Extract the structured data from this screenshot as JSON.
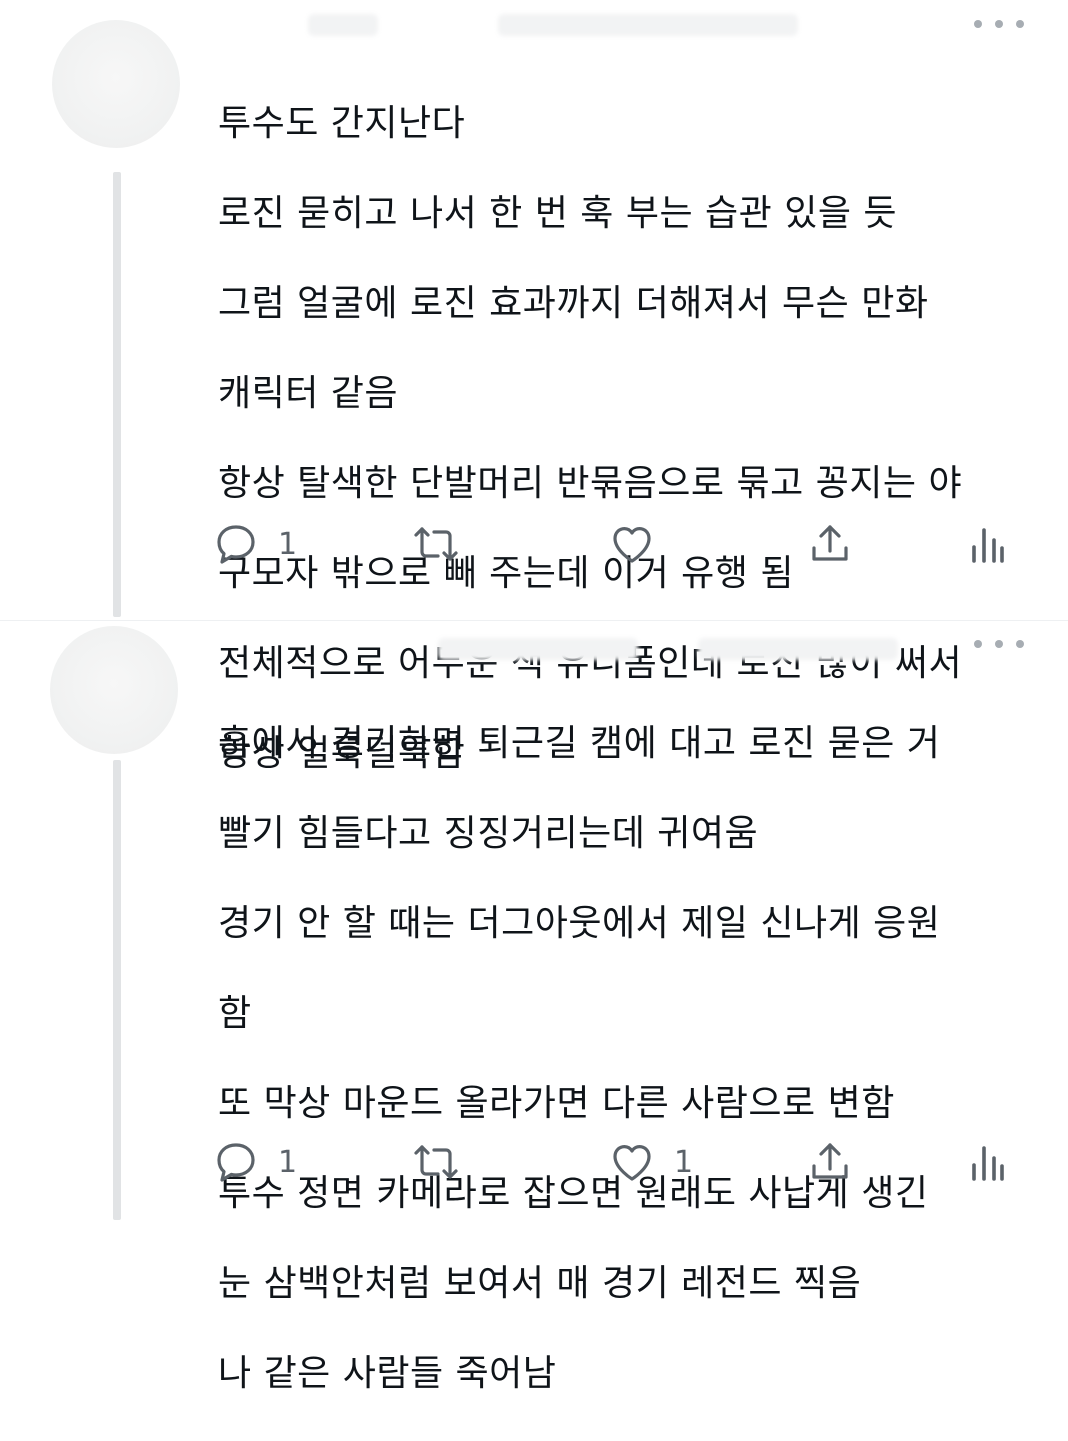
{
  "tweets": [
    {
      "text": "투수도 간지난다\n로진 묻히고 나서 한 번 훅 부는 습관 있을 듯\n그럼 얼굴에 로진 효과까지 더해져서 무슨 만화 캐릭터 같음\n항상 탈색한 단발머리 반묶음으로 묶고 꽁지는 야구모자 밖으로 빼 주는데 이거 유행 됨\n전체적으로 어두운 색 유니폼인데 로진 많이 써서 항상 얼룩덜룩함",
      "lines": [
        "투수도 간지난다",
        "로진 묻히고 나서 한 번 훅 부는 습관 있을 듯",
        "그럼 얼굴에 로진 효과까지 더해져서 무슨 만화",
        "캐릭터 같음",
        "항상 탈색한 단발머리 반묶음으로 묶고 꽁지는 야",
        "구모자 밖으로 빼 주는데 이거 유행 됨",
        "전체적으로 어두운 색 유니폼인데 로진 많이 써서",
        "항상 얼룩덜룩함"
      ],
      "actions": {
        "reply_count": "1",
        "retweet_count": "",
        "like_count": ""
      }
    },
    {
      "lines": [
        "홈에서 경기하면 퇴근길 캠에 대고 로진 묻은 거",
        "빨기 힘들다고 징징거리는데 귀여움",
        "경기 안 할 때는 더그아웃에서 제일 신나게 응원",
        "함",
        "또 막상 마운드 올라가면 다른 사람으로 변함",
        "투수 정면 카메라로 잡으면 원래도 사납게 생긴",
        "눈 삼백안처럼 보여서 매 경기 레전드 찍음",
        "나 같은 사람들 죽어남"
      ],
      "actions": {
        "reply_count": "1",
        "retweet_count": "",
        "like_count": "1"
      }
    }
  ],
  "icons": {
    "reply": "reply-icon",
    "retweet": "retweet-icon",
    "like": "heart-icon",
    "share": "share-icon",
    "analytics": "analytics-icon",
    "more": "more-icon"
  },
  "colors": {
    "text": "#0f1419",
    "icon": "#5b6269",
    "thread_line": "#e1e3e5",
    "more_dots": "#a7adb3"
  }
}
